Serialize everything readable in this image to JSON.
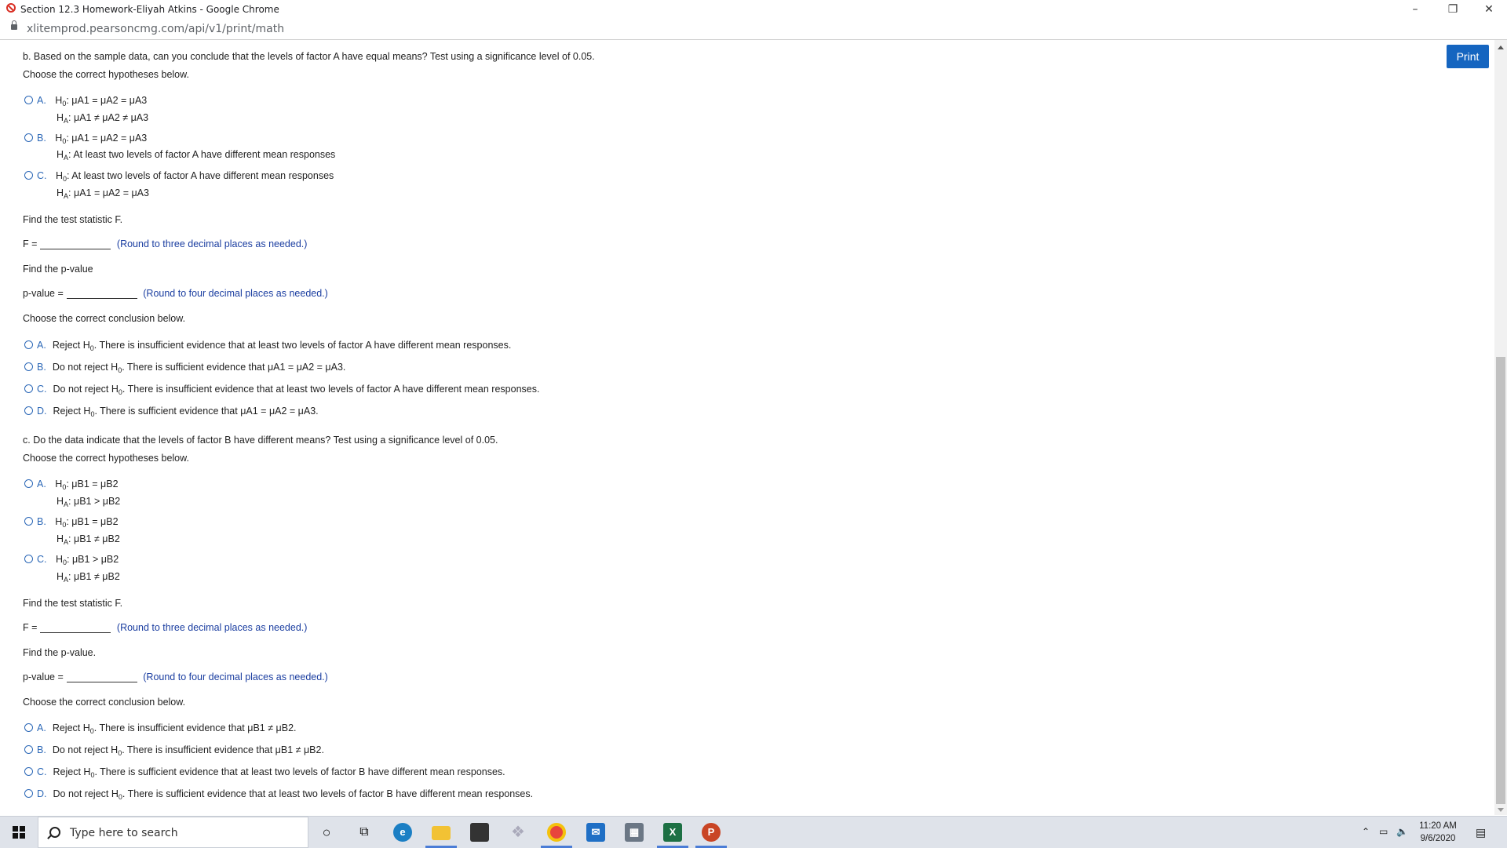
{
  "window": {
    "title": "Section 12.3 Homework-Eliyah Atkins - Google Chrome",
    "url": "xlitemprod.pearsoncmg.com/api/v1/print/math",
    "minimize": "–",
    "restore": "❐",
    "close": "✕"
  },
  "print_button": "Print",
  "part_b": {
    "question": "b. Based on the sample data, can you conclude that the levels of factor A have equal means? Test using a significance level of 0.05.",
    "hyp_prompt": "Choose the correct hypotheses below.",
    "hypotheses": [
      {
        "letter": "A.",
        "h0": "μA1 = μA2 = μA3",
        "ha": "μA1 ≠ μA2 ≠ μA3"
      },
      {
        "letter": "B.",
        "h0": "μA1 = μA2 = μA3",
        "ha": "At least two levels of factor A have different mean responses"
      },
      {
        "letter": "C.",
        "h0": "At least two levels of factor A have different mean responses",
        "ha": "μA1 = μA2 = μA3"
      }
    ],
    "f_prompt": "Find the test statistic F.",
    "f_label": "F =",
    "f_hint": "(Round to three decimal places as needed.)",
    "p_prompt": "Find the p-value",
    "p_label": "p-value =",
    "p_hint": "(Round to four decimal places as needed.)",
    "conc_prompt": "Choose the correct conclusion below.",
    "conclusions": [
      {
        "letter": "A.",
        "action": "Reject H",
        "text": ". There is insufficient evidence that at least two levels of factor A have different mean responses."
      },
      {
        "letter": "B.",
        "action": "Do not reject H",
        "text": ". There is sufficient evidence that μA1 = μA2 = μA3."
      },
      {
        "letter": "C.",
        "action": "Do not reject H",
        "text": ". There is insufficient evidence that at least two levels of factor A have different mean responses."
      },
      {
        "letter": "D.",
        "action": "Reject H",
        "text": ". There is sufficient evidence that μA1 = μA2 = μA3."
      }
    ]
  },
  "part_c": {
    "question": "c. Do the data indicate that the levels of factor B have different means? Test using a significance level of 0.05.",
    "hyp_prompt": "Choose the correct hypotheses below.",
    "hypotheses": [
      {
        "letter": "A.",
        "h0": "μB1 = μB2",
        "ha": "μB1 > μB2"
      },
      {
        "letter": "B.",
        "h0": "μB1 = μB2",
        "ha": "μB1 ≠ μB2"
      },
      {
        "letter": "C.",
        "h0": "μB1 > μB2",
        "ha": "μB1 ≠ μB2"
      }
    ],
    "f_prompt": "Find the test statistic F.",
    "f_label": "F =",
    "f_hint": "(Round to three decimal places as needed.)",
    "p_prompt": "Find the p-value.",
    "p_label": "p-value =",
    "p_hint": "(Round to four decimal places as needed.)",
    "conc_prompt": "Choose the correct conclusion below.",
    "conclusions": [
      {
        "letter": "A.",
        "action": "Reject H",
        "text": ". There is insufficient evidence that μB1 ≠ μB2."
      },
      {
        "letter": "B.",
        "action": "Do not reject H",
        "text": ". There is insufficient evidence that μB1 ≠ μB2."
      },
      {
        "letter": "C.",
        "action": "Reject H",
        "text": ". There is sufficient evidence that at least two levels of factor B have different mean responses."
      },
      {
        "letter": "D.",
        "action": "Do not reject H",
        "text": ". There is sufficient evidence that at least two levels of factor B have different mean responses."
      }
    ]
  },
  "labels": {
    "h0": "H",
    "h0_sub": "0",
    "ha": "H",
    "ha_sub": "A"
  },
  "taskbar": {
    "search_placeholder": "Type here to search",
    "time": "11:20 AM",
    "date": "9/6/2020",
    "excel": "X",
    "powerpoint": "P"
  }
}
